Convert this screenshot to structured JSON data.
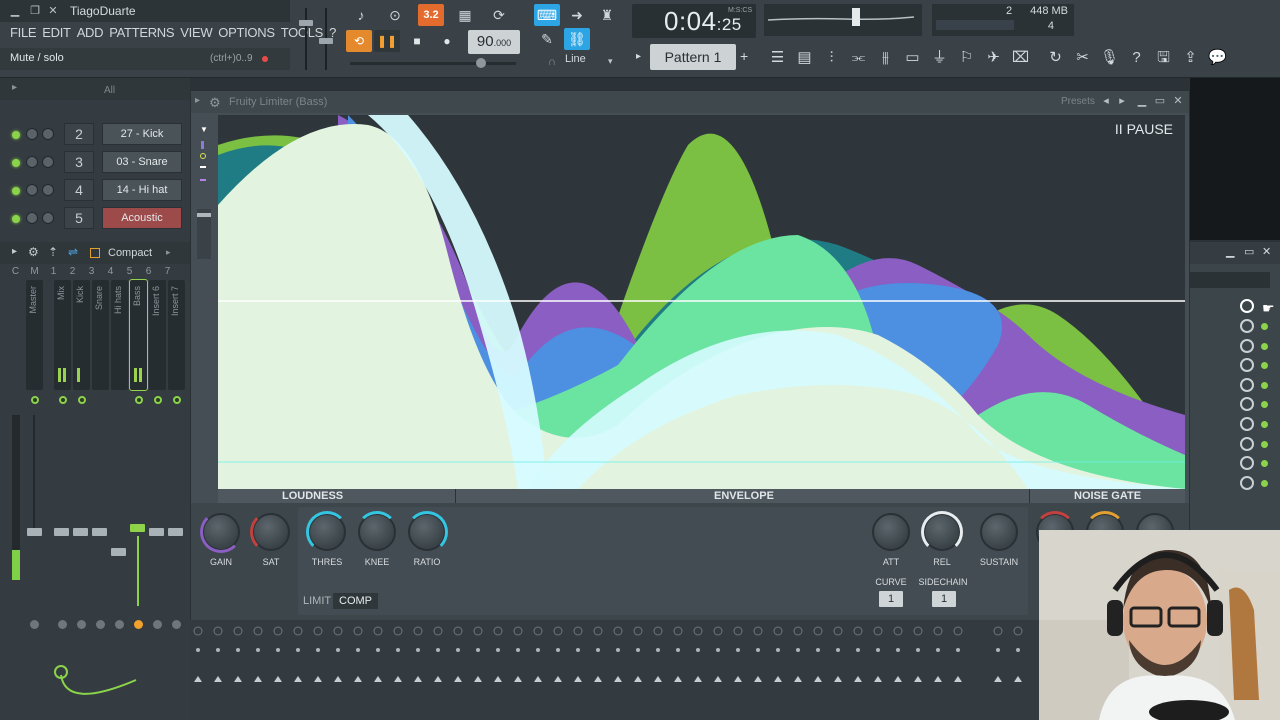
{
  "window": {
    "user": "TiagoDuarte"
  },
  "menu": [
    "FILE",
    "EDIT",
    "ADD",
    "PATTERNS",
    "VIEW",
    "OPTIONS",
    "TOOLS",
    "?"
  ],
  "hint": {
    "text": "Mute / solo",
    "shortcut": "(ctrl+)0..9"
  },
  "transport": {
    "bpm": "90",
    "bpm_fraction": ".000",
    "time_main": "0:04",
    "time_sub": ":25",
    "time_unit": "M:S:CS",
    "pattern": "Pattern 1",
    "snap": "Line",
    "pattern_add": "+"
  },
  "cpu": {
    "ram": "448 MB",
    "cpu_value": "2",
    "polyphony": "4"
  },
  "channel_filter": "All",
  "channels": [
    {
      "num": "2",
      "name": "27 - Kick",
      "selected": false
    },
    {
      "num": "3",
      "name": "03 - Snare",
      "selected": false
    },
    {
      "num": "4",
      "name": "14 - Hi hat",
      "selected": false
    },
    {
      "num": "5",
      "name": "Acoustic",
      "selected": true
    }
  ],
  "mixer": {
    "mode": "Compact",
    "col_headers": [
      "C",
      "M",
      "1",
      "2",
      "3",
      "4",
      "5",
      "6",
      "7"
    ],
    "tracks": [
      "Master",
      "Mix",
      "Kick",
      "Snare",
      "Hi hats",
      "Bass",
      "Insert 6",
      "Insert 7"
    ]
  },
  "plugin": {
    "name": "Fruity Limiter",
    "target": "(Bass)",
    "presets_label": "Presets",
    "pause_label": "II PAUSE",
    "sections": {
      "loudness": "LOUDNESS",
      "envelope": "ENVELOPE",
      "noise_gate": "NOISE GATE"
    },
    "knobs": {
      "gain": "GAIN",
      "sat": "SAT",
      "thres": "THRES",
      "knee": "KNEE",
      "ratio": "RATIO",
      "att": "ATT",
      "rel": "REL",
      "sustain": "SUSTAIN"
    },
    "curve": {
      "label": "CURVE",
      "value": "1"
    },
    "sidechain": {
      "label": "SIDECHAIN",
      "value": "1"
    },
    "modes": {
      "limit": "LIMIT",
      "comp": "COMP",
      "active": "COMP"
    },
    "colors": {
      "green": "#7bbf43",
      "teal": "#1f7c84",
      "purple": "#8a5ec2",
      "blue": "#4d8fe0",
      "mint": "#6be3a1",
      "pale": "#e2f4df",
      "cyan": "#d6fbff"
    }
  }
}
